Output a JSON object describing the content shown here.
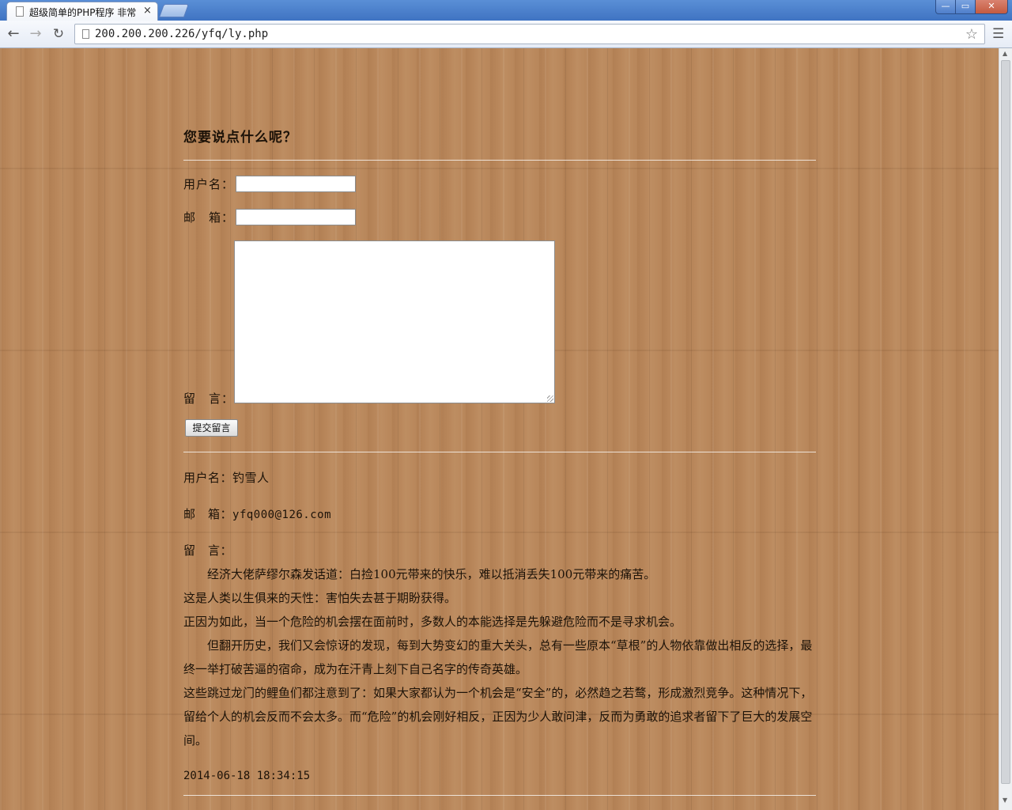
{
  "browser": {
    "tab_title": "超级简单的PHP程序 非常",
    "tab_close": "×",
    "url": "200.200.200.226/yfq/ly.php",
    "window_buttons": {
      "minimize": "—",
      "maximize": "▭",
      "close": "✕"
    }
  },
  "form": {
    "heading": "您要说点什么呢？",
    "username_label": "用户名：",
    "email_label": "邮　箱：",
    "message_label": "留　言：",
    "username_value": "",
    "email_value": "",
    "message_value": "",
    "submit_label": "提交留言"
  },
  "entry": {
    "username_label": "用户名：",
    "username": "钓雪人",
    "email_label": "邮　箱：",
    "email": "yfq000@126.com",
    "message_label": "留　言：",
    "paragraphs": [
      "经济大佬萨缪尔森发话道：白捡100元带来的快乐，难以抵消丢失100元带来的痛苦。",
      "这是人类以生俱来的天性：害怕失去甚于期盼获得。",
      "正因为如此，当一个危险的机会摆在面前时，多数人的本能选择是先躲避危险而不是寻求机会。",
      "但翻开历史，我们又会惊讶的发现，每到大势变幻的重大关头，总有一些原本“草根”的人物依靠做出相反的选择，最终一举打破苦逼的宿命，成为在汗青上刻下自己名字的传奇英雄。",
      "这些跳过龙门的鲤鱼们都注意到了：如果大家都认为一个机会是“安全”的，必然趋之若鹜，形成激烈竞争。这种情况下，留给个人的机会反而不会太多。而“危险”的机会刚好相反，正因为少人敢问津，反而为勇敢的追求者留下了巨大的发展空间。"
    ],
    "timestamp": "2014-06-18 18:34:15"
  }
}
